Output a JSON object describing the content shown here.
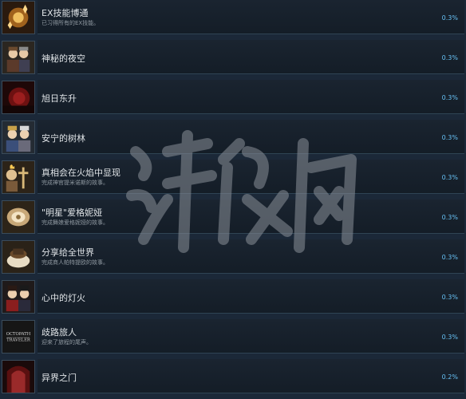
{
  "achievements": [
    {
      "title": "EX技能博通",
      "desc": "已习得所有的EX技能。",
      "pct": "0.3%",
      "icon": "ex-skills-icon"
    },
    {
      "title": "神秘的夜空",
      "desc": "",
      "pct": "0.3%",
      "icon": "mysterious-night-sky-icon"
    },
    {
      "title": "旭日东升",
      "desc": "",
      "pct": "0.3%",
      "icon": "rising-sun-icon"
    },
    {
      "title": "安宁的树林",
      "desc": "",
      "pct": "0.3%",
      "icon": "peaceful-forest-icon"
    },
    {
      "title": "真相会在火焰中显现",
      "desc": "完成神官提米诺斯的故事。",
      "pct": "0.3%",
      "icon": "truth-in-flames-icon"
    },
    {
      "title": "\"明星\"爱格妮娅",
      "desc": "完成舞娘爱格妮娅的故事。",
      "pct": "0.3%",
      "icon": "star-agnea-icon"
    },
    {
      "title": "分享给全世界",
      "desc": "完成商人帕特提欧的故事。",
      "pct": "0.3%",
      "icon": "share-with-world-icon"
    },
    {
      "title": "心中的灯火",
      "desc": "",
      "pct": "0.3%",
      "icon": "lamp-in-heart-icon"
    },
    {
      "title": "歧路旅人",
      "desc": "迎来了旅程的尾声。",
      "pct": "0.3%",
      "icon": "octopath-traveler-logo-icon"
    },
    {
      "title": "异界之门",
      "desc": "",
      "pct": "0.2%",
      "icon": "otherworld-gate-icon"
    }
  ],
  "colors": {
    "background": "#1b2838",
    "percent": "#66c0f4",
    "title": "#dfe3e6",
    "desc": "#8f98a0"
  },
  "watermark_text": "游侠网"
}
